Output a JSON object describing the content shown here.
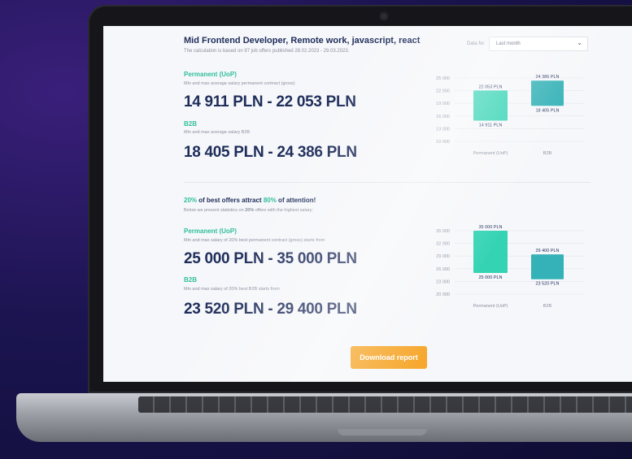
{
  "report": {
    "title": "Mid Frontend Developer, Remote work, javascript, react",
    "subtitle": "The calculation is based on 97 job offers published 28.02.2023 - 29.03.2023.",
    "data_for_label": "Data for",
    "period_select": "Last month"
  },
  "average": {
    "permanent_label": "Permanent (UoP)",
    "permanent_desc": "Min and max average salary permanent contract (gross)",
    "permanent_range": "14 911 PLN - 22 053 PLN",
    "b2b_label": "B2B",
    "b2b_desc": "Min and max average salary B2B",
    "b2b_range": "18 405 PLN - 24 386 PLN"
  },
  "best": {
    "headline_pct1": "20%",
    "headline_mid": " of best offers attract ",
    "headline_pct2": "80%",
    "headline_end": " of attention!",
    "desc_pre": "Below we present statistics on ",
    "desc_pct": "20%",
    "desc_post": " offers with the highest salary:",
    "permanent_label": "Permanent (UoP)",
    "permanent_desc": "Min and max salary of 20% best permanent contract (gross) starts from",
    "permanent_range": "25 000 PLN - 35 000 PLN",
    "b2b_label": "B2B",
    "b2b_desc": "Min and max salary of 20% best B2B starts from",
    "b2b_range": "23 520 PLN - 29 400 PLN"
  },
  "download_label": "Download report",
  "colors": {
    "accent_green": "#2fbf9c",
    "bar_permanent": "#34d3b4",
    "bar_b2b": "#35b2b7",
    "button": "#f6a62a",
    "heading": "#1e2d5a"
  },
  "chart_data": [
    {
      "type": "bar",
      "categories": [
        "Permanent (UoP)",
        "B2B"
      ],
      "series": [
        {
          "min": 14911,
          "max": 22053,
          "min_label": "14 911 PLN",
          "max_label": "22 053 PLN"
        },
        {
          "min": 18405,
          "max": 24386,
          "min_label": "18 405 PLN",
          "max_label": "24 386 PLN"
        }
      ],
      "yticks": [
        10000,
        13000,
        16000,
        19000,
        22000,
        25000
      ],
      "ytick_labels": [
        "10 000",
        "13 000",
        "16 000",
        "19 000",
        "22 000",
        "25 000"
      ],
      "ylim": [
        10000,
        25000
      ],
      "grid": true
    },
    {
      "type": "bar",
      "categories": [
        "Permanent (UoP)",
        "B2B"
      ],
      "series": [
        {
          "min": 25000,
          "max": 35000,
          "min_label": "25 000 PLN",
          "max_label": "35 000 PLN"
        },
        {
          "min": 23520,
          "max": 29400,
          "min_label": "23 520 PLN",
          "max_label": "29 400 PLN"
        }
      ],
      "yticks": [
        20000,
        23000,
        26000,
        29000,
        32000,
        35000
      ],
      "ytick_labels": [
        "20 000",
        "23 000",
        "26 000",
        "29 000",
        "32 000",
        "35 000"
      ],
      "ylim": [
        20000,
        35000
      ],
      "grid": true
    }
  ]
}
